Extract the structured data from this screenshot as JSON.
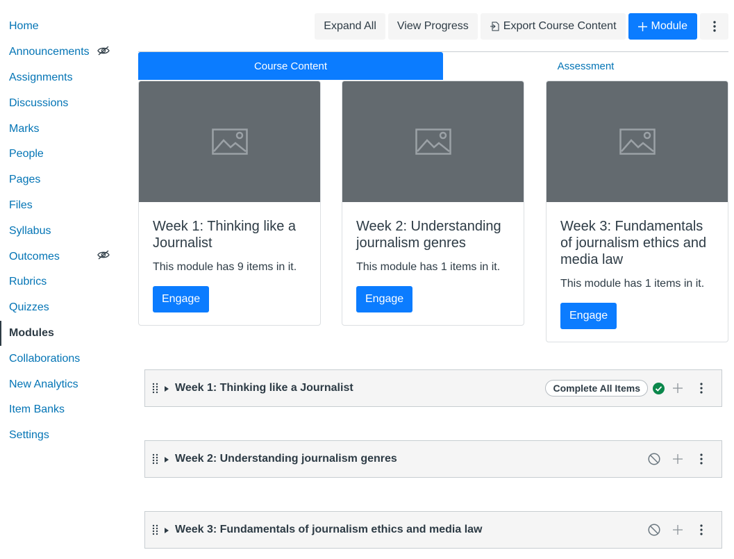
{
  "sidebar": {
    "items": [
      {
        "label": "Home",
        "hidden": false,
        "active": false
      },
      {
        "label": "Announcements",
        "hidden": true,
        "active": false
      },
      {
        "label": "Assignments",
        "hidden": false,
        "active": false
      },
      {
        "label": "Discussions",
        "hidden": false,
        "active": false
      },
      {
        "label": "Marks",
        "hidden": false,
        "active": false
      },
      {
        "label": "People",
        "hidden": false,
        "active": false
      },
      {
        "label": "Pages",
        "hidden": false,
        "active": false
      },
      {
        "label": "Files",
        "hidden": false,
        "active": false
      },
      {
        "label": "Syllabus",
        "hidden": false,
        "active": false
      },
      {
        "label": "Outcomes",
        "hidden": true,
        "active": false
      },
      {
        "label": "Rubrics",
        "hidden": false,
        "active": false
      },
      {
        "label": "Quizzes",
        "hidden": false,
        "active": false
      },
      {
        "label": "Modules",
        "hidden": false,
        "active": true
      },
      {
        "label": "Collaborations",
        "hidden": false,
        "active": false
      },
      {
        "label": "New Analytics",
        "hidden": false,
        "active": false
      },
      {
        "label": "Item Banks",
        "hidden": false,
        "active": false
      },
      {
        "label": "Settings",
        "hidden": false,
        "active": false
      }
    ]
  },
  "toolbar": {
    "expand_all": "Expand All",
    "view_progress": "View Progress",
    "export": "Export Course Content",
    "add_module": "Module",
    "more_icon": "kebab-icon"
  },
  "tabs": [
    {
      "label": "Course Content",
      "active": true
    },
    {
      "label": "Assessment",
      "active": false
    }
  ],
  "cards": [
    {
      "title": "Week 1: Thinking like a Journalist",
      "desc": "This module has 9 items in it.",
      "button": "Engage"
    },
    {
      "title": "Week 2: Understanding journalism genres",
      "desc": "This module has 1 items in it.",
      "button": "Engage"
    },
    {
      "title": "Week 3: Fundamentals of journalism ethics and media law",
      "desc": "This module has 1 items in it.",
      "button": "Engage"
    }
  ],
  "modules": [
    {
      "title": "Week 1: Thinking like a Journalist",
      "requirement": "Complete All Items",
      "status": "published"
    },
    {
      "title": "Week 2: Understanding journalism genres",
      "requirement": "",
      "status": "unpublished"
    },
    {
      "title": "Week 3: Fundamentals of journalism ethics and media law",
      "requirement": "",
      "status": "unpublished"
    }
  ],
  "colors": {
    "accent": "#0b7cff",
    "link": "#0374b5",
    "published": "#0b874b",
    "text": "#2d3b45"
  }
}
